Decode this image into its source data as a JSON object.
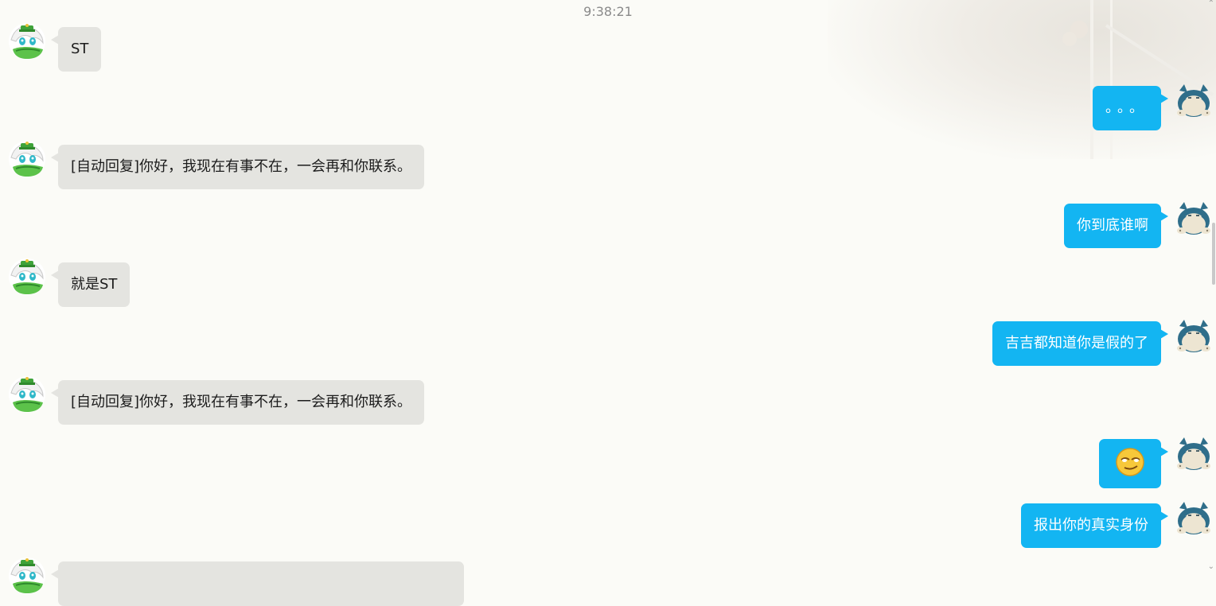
{
  "chat": {
    "timestamp": "9:38:21",
    "messages": [
      {
        "sender": "contact",
        "text": "ST"
      },
      {
        "sender": "me",
        "text": "。。。"
      },
      {
        "sender": "contact",
        "text": "[自动回复]你好，我现在有事不在，一会再和你联系。"
      },
      {
        "sender": "me",
        "text": "你到底谁啊"
      },
      {
        "sender": "contact",
        "text": "就是ST"
      },
      {
        "sender": "me",
        "text": "吉吉都知道你是假的了"
      },
      {
        "sender": "contact",
        "text": "[自动回复]你好，我现在有事不在，一会再和你联系。"
      },
      {
        "sender": "me",
        "emoji": "smirk-face-emoji"
      },
      {
        "sender": "me",
        "text": "报出你的真实身份"
      },
      {
        "sender": "contact",
        "text": ""
      }
    ]
  },
  "avatars": {
    "contact": "contact-avatar-green-hat-character",
    "me": "snorlax-avatar"
  },
  "colors": {
    "background": "#fbfbf7",
    "incoming_bubble": "#e4e4e0",
    "outgoing_bubble": "#13b5f2",
    "outgoing_text": "#ffffff",
    "timestamp_text": "#8a8a8a"
  }
}
